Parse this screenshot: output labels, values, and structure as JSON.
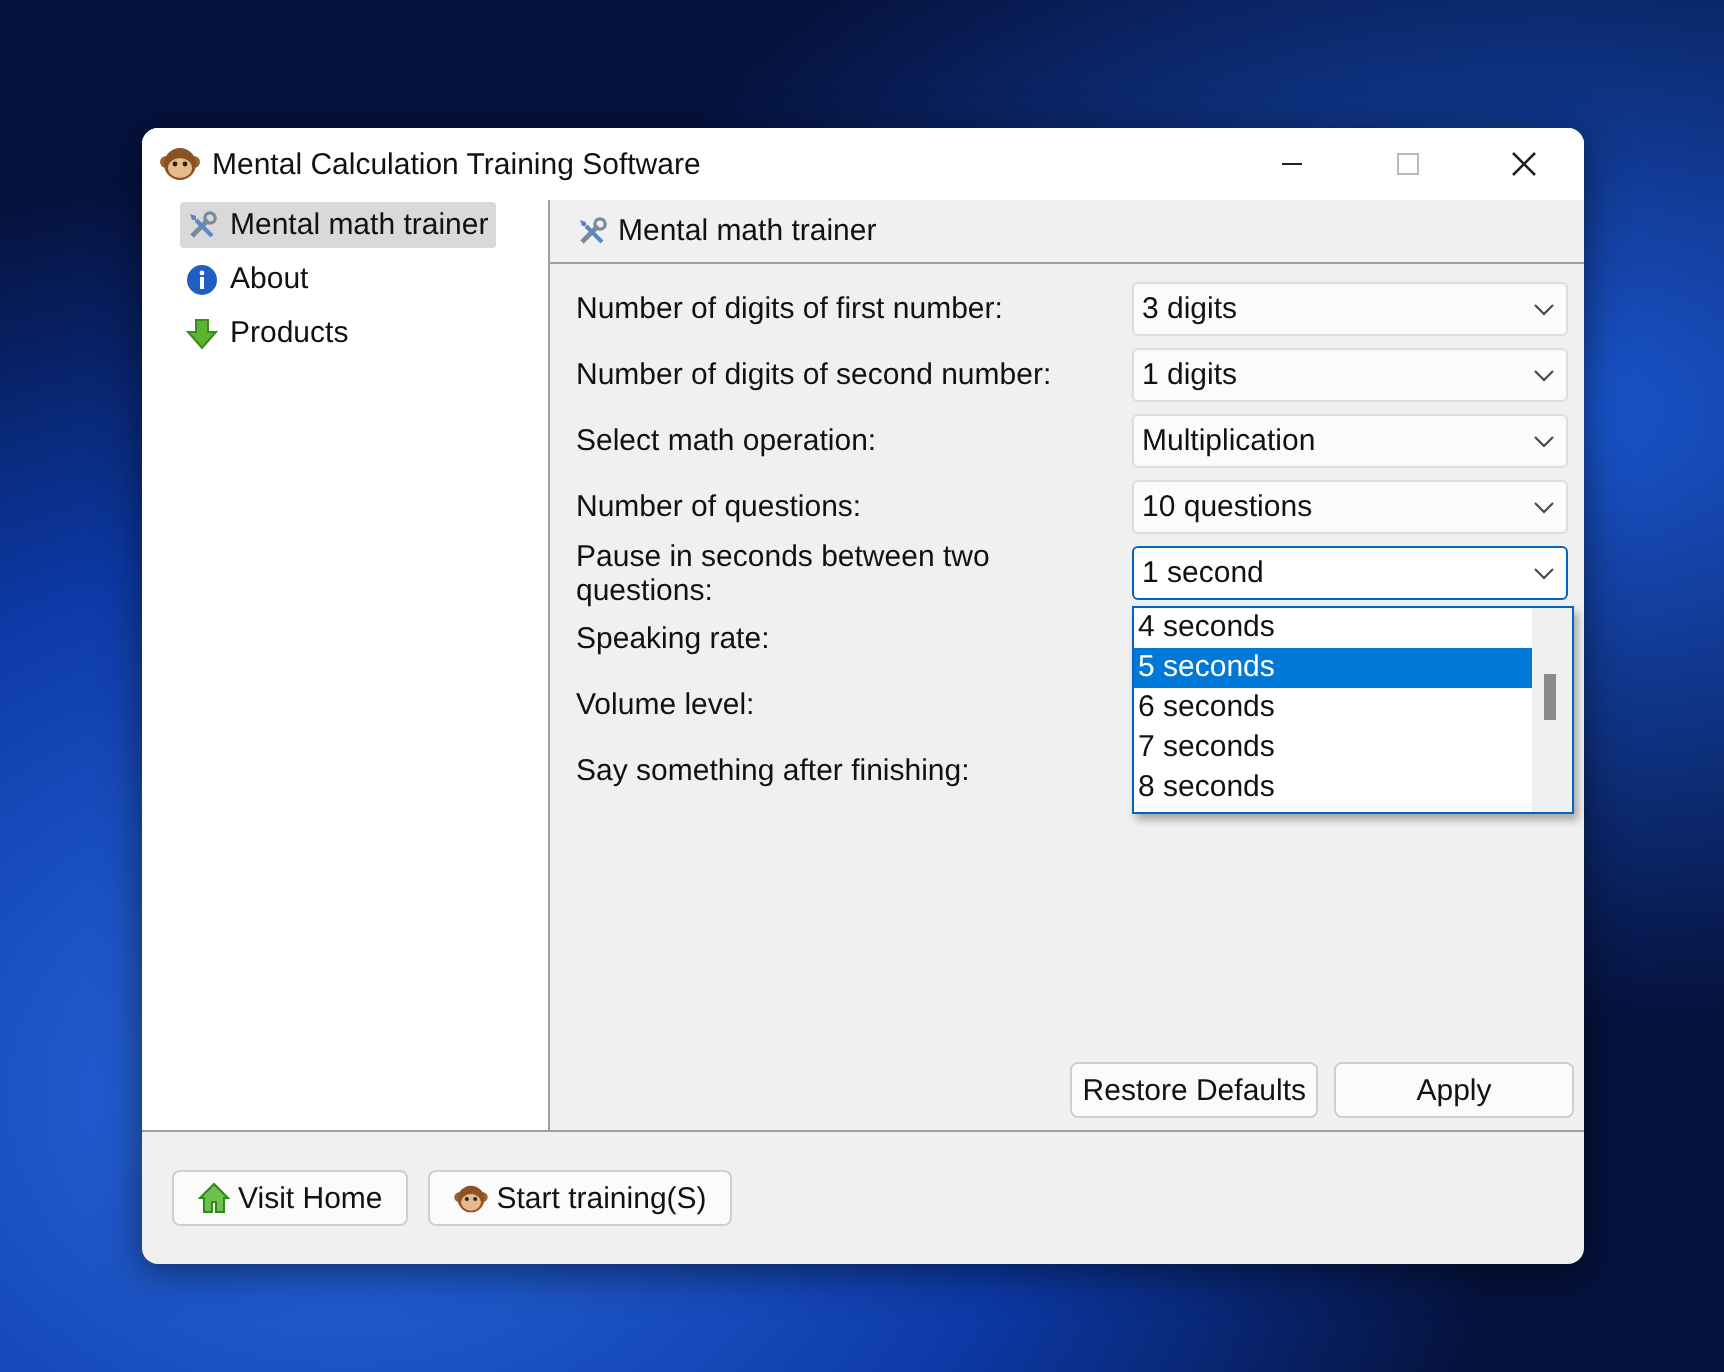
{
  "window": {
    "title": "Mental Calculation Training Software"
  },
  "sidebar": {
    "items": [
      {
        "label": "Mental math trainer",
        "kind": "tools",
        "selected": true
      },
      {
        "label": "About",
        "kind": "info",
        "selected": false
      },
      {
        "label": "Products",
        "kind": "download",
        "selected": false
      }
    ]
  },
  "panel": {
    "title": "Mental math trainer",
    "rows": [
      {
        "label": "Number of digits of first number:",
        "value": "3 digits",
        "focused": false
      },
      {
        "label": "Number of digits of second number:",
        "value": "1 digits",
        "focused": false
      },
      {
        "label": "Select math operation:",
        "value": "Multiplication",
        "focused": false
      },
      {
        "label": "Number of questions:",
        "value": "10 questions",
        "focused": false
      },
      {
        "label": "Pause in seconds between two questions:",
        "value": "1 second",
        "focused": true
      },
      {
        "label": "Speaking rate:"
      },
      {
        "label": "Volume level:"
      },
      {
        "label": "Say something after finishing:"
      }
    ],
    "dropdown_list": {
      "items": [
        {
          "label": "4 seconds",
          "selected": false
        },
        {
          "label": "5 seconds",
          "selected": true
        },
        {
          "label": "6 seconds",
          "selected": false
        },
        {
          "label": "7 seconds",
          "selected": false
        },
        {
          "label": "8 seconds",
          "selected": false
        }
      ]
    },
    "buttons": [
      "Restore Defaults",
      "Apply"
    ]
  },
  "footer_buttons": [
    {
      "label": "Visit Home",
      "kind": "home"
    },
    {
      "label": "Start training(S)",
      "kind": "monkey"
    }
  ]
}
